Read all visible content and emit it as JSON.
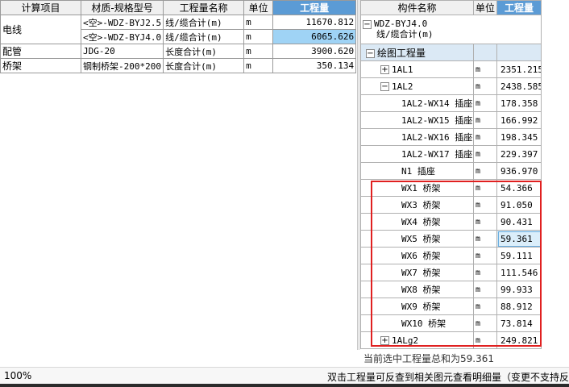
{
  "left_table": {
    "headers": [
      "计算项目",
      "材质-规格型号",
      "工程量名称",
      "单位",
      "工程量"
    ],
    "rows": [
      {
        "category": "电线",
        "spec": "<空>-WDZ-BYJ2.5",
        "name": "线/缆合计(m)",
        "unit": "m",
        "value": "11670.812"
      },
      {
        "category": "",
        "spec": "<空>-WDZ-BYJ4.0",
        "name": "线/缆合计(m)",
        "unit": "m",
        "value": "6065.626"
      },
      {
        "category": "配管",
        "spec": "JDG-20",
        "name": "长度合计(m)",
        "unit": "m",
        "value": "3900.620"
      },
      {
        "category": "桥架",
        "spec": "钢制桥架-200*200",
        "name": "长度合计(m)",
        "unit": "m",
        "value": "350.134"
      }
    ]
  },
  "right_table": {
    "headers": [
      "构件名称",
      "单位",
      "工程量"
    ],
    "top_line1": "WDZ-BYJ4.0",
    "top_line2": "线/缆合计(m)",
    "group": "绘图工程量",
    "rows": [
      {
        "name": "1AL1",
        "unit": "m",
        "value": "2351.215",
        "toggle": "+"
      },
      {
        "name": "1AL2",
        "unit": "m",
        "value": "2438.585",
        "toggle": "−"
      },
      {
        "name": "1AL2-WX14 插座",
        "unit": "m",
        "value": "178.358"
      },
      {
        "name": "1AL2-WX15 插座",
        "unit": "m",
        "value": "166.992"
      },
      {
        "name": "1AL2-WX16 插座",
        "unit": "m",
        "value": "198.345"
      },
      {
        "name": "1AL2-WX17 插座",
        "unit": "m",
        "value": "229.397"
      },
      {
        "name": "N1 插座",
        "unit": "m",
        "value": "936.970"
      },
      {
        "name": "WX1 桥架",
        "unit": "m",
        "value": "54.366"
      },
      {
        "name": "WX3 桥架",
        "unit": "m",
        "value": "91.050"
      },
      {
        "name": "WX4 桥架",
        "unit": "m",
        "value": "90.431"
      },
      {
        "name": "WX5 桥架",
        "unit": "m",
        "value": "59.361"
      },
      {
        "name": "WX6 桥架",
        "unit": "m",
        "value": "59.111"
      },
      {
        "name": "WX7 桥架",
        "unit": "m",
        "value": "111.546"
      },
      {
        "name": "WX8 桥架",
        "unit": "m",
        "value": "99.933"
      },
      {
        "name": "WX9 桥架",
        "unit": "m",
        "value": "88.912"
      },
      {
        "name": "WX10 桥架",
        "unit": "m",
        "value": "73.814"
      },
      {
        "name": "1ALg2",
        "unit": "m",
        "value": "249.821",
        "toggle": "+"
      }
    ]
  },
  "status": {
    "selection_sum": "当前选中工程量总和为59.361",
    "zoom": "100%",
    "hint": "双击工程量可反查到相关图元查看明细量（变更不支持反"
  },
  "colors": {
    "header_highlight": "#5b9bd5",
    "selected_cell": "#9fd3f5",
    "red_box": "#e02020"
  }
}
